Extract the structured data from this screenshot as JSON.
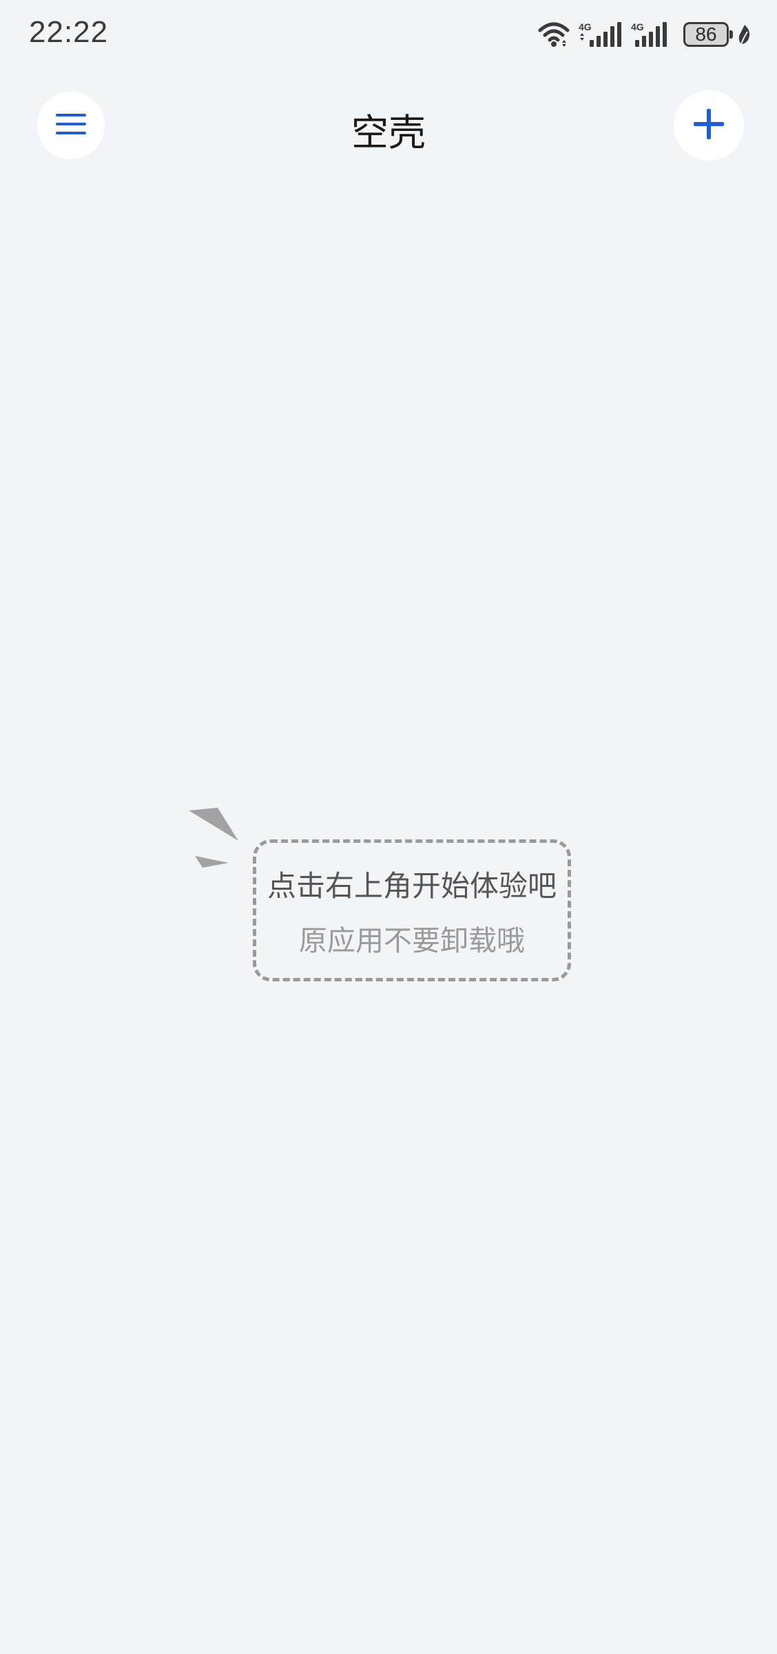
{
  "status_bar": {
    "time": "22:22",
    "battery_level": "86",
    "icons": [
      "wifi-icon",
      "4g-signal-icon",
      "4g-signal-icon",
      "battery-icon",
      "leaf-icon"
    ]
  },
  "header": {
    "title": "空壳",
    "menu_icon": "hamburger-menu-icon",
    "add_icon": "plus-icon"
  },
  "empty_state": {
    "primary_text": "点击右上角开始体验吧",
    "secondary_text": "原应用不要卸载哦"
  },
  "colors": {
    "background": "#f2f5f8",
    "accent": "#1d5fd9",
    "text_primary": "#555555",
    "text_secondary": "#9a9a9a"
  }
}
